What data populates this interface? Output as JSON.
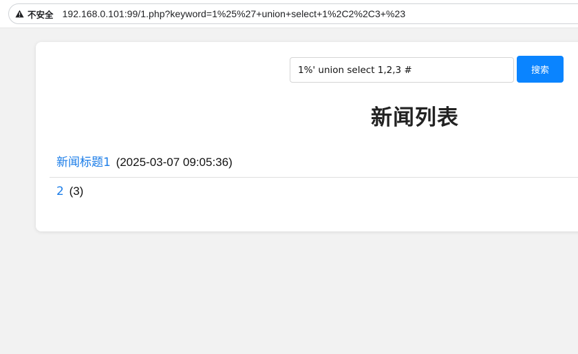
{
  "browser": {
    "security_label": "不安全",
    "url": "192.168.0.101:99/1.php?keyword=1%25%27+union+select+1%2C2%2C3+%23"
  },
  "search": {
    "value": "1%' union select 1,2,3 #",
    "button_label": "搜索"
  },
  "page": {
    "title": "新闻列表"
  },
  "news": [
    {
      "title": "新闻标题1",
      "meta": "(2025-03-07 09:05:36)"
    },
    {
      "title": "2",
      "meta": "(3)"
    }
  ],
  "colors": {
    "accent": "#0a84ff",
    "link": "#1a7ce8",
    "background": "#f2f2f2"
  },
  "icons": {
    "security": "warning-triangle-icon"
  }
}
